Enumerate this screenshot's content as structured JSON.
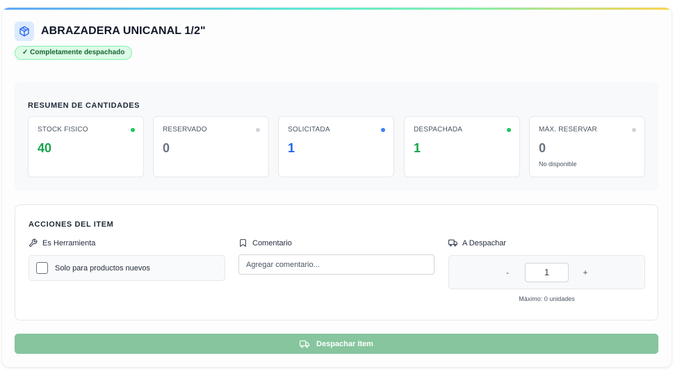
{
  "item": {
    "title": "ABRAZADERA UNICANAL 1/2\"",
    "status": "✓ Completamente despachado"
  },
  "summary": {
    "title": "RESUMEN DE CANTIDADES",
    "stats": [
      {
        "label": "STOCK FISICO",
        "value": "40",
        "color": "#16a34a",
        "dot": "#22c55e",
        "note": ""
      },
      {
        "label": "RESERVADO",
        "value": "0",
        "color": "#6b7280",
        "dot": "#d1d5db",
        "note": ""
      },
      {
        "label": "SOLICITADA",
        "value": "1",
        "color": "#2563eb",
        "dot": "#3b82f6",
        "note": ""
      },
      {
        "label": "DESPACHADA",
        "value": "1",
        "color": "#16a34a",
        "dot": "#22c55e",
        "note": ""
      },
      {
        "label": "MÁX. RESERVAR",
        "value": "0",
        "color": "#6b7280",
        "dot": "#d1d5db",
        "note": "No disponible"
      }
    ]
  },
  "actions": {
    "title": "ACCIONES DEL ITEM",
    "tool": {
      "label": "Es Herramienta",
      "checkbox_label": "Solo para productos nuevos",
      "checked": false
    },
    "comment": {
      "label": "Comentario",
      "placeholder": "Agregar comentario...",
      "value": ""
    },
    "dispatch": {
      "label": "A Despachar",
      "minus": "-",
      "plus": "+",
      "value": "1",
      "max_note": "Máximo: 0 unidades"
    }
  },
  "submit": {
    "label": "Despachar Item",
    "color": "#86c59e"
  },
  "icons": {
    "header": "box-icon",
    "tool": "wrench-icon",
    "comment": "bookmark-icon",
    "dispatch": "truck-icon"
  }
}
